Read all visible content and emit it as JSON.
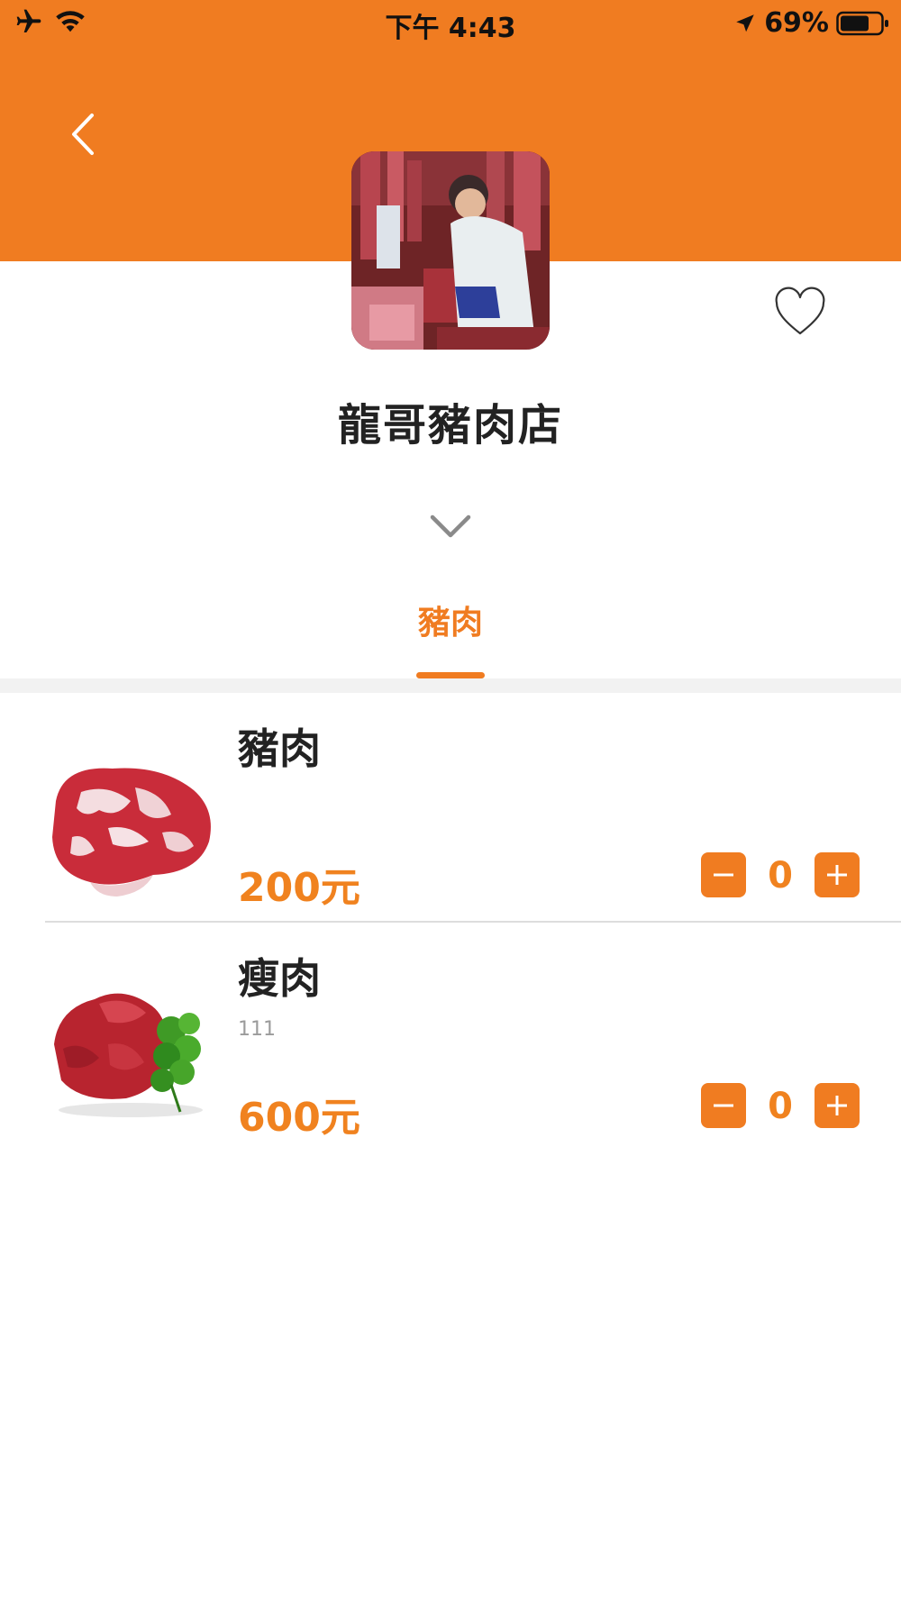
{
  "status_bar": {
    "time": "下午 4:43",
    "battery": "69%",
    "icons": [
      "airplane-icon",
      "wifi-icon",
      "location-arrow-icon",
      "battery-icon"
    ]
  },
  "colors": {
    "brand": "#F07C21",
    "price": "#F0821F",
    "text": "#222222",
    "muted": "#9B9B9B"
  },
  "shop": {
    "name": "龍哥豬肉店"
  },
  "tabs": [
    {
      "label": "豬肉",
      "active": true
    }
  ],
  "products": [
    {
      "name": "豬肉",
      "description": "",
      "price": "200元",
      "quantity": "0"
    },
    {
      "name": "瘦肉",
      "description": "111",
      "price": "600元",
      "quantity": "0"
    }
  ]
}
